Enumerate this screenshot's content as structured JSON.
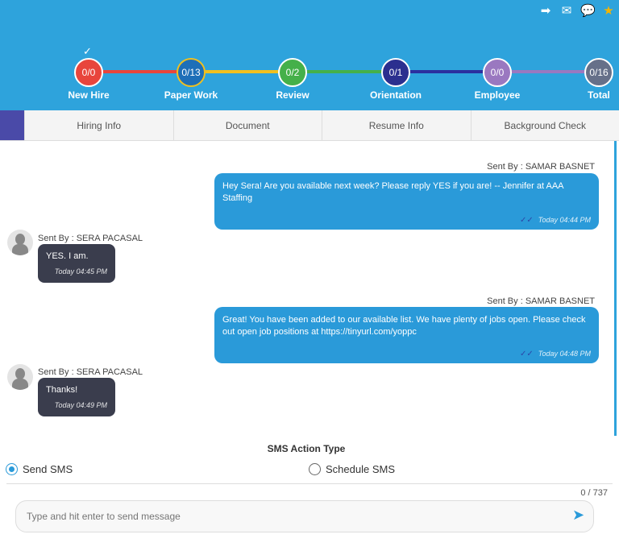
{
  "header": {
    "icons": [
      "arrow-right-icon",
      "mail-icon",
      "chat-icon",
      "star-icon"
    ],
    "steps": [
      {
        "label": "New Hire",
        "count": "0/0",
        "color": "#e8453c",
        "done": true
      },
      {
        "label": "Paper Work",
        "count": "0/13",
        "color": "#1e6fb8",
        "ring": "#f0c020"
      },
      {
        "label": "Review",
        "count": "0/2",
        "color": "#45b04a"
      },
      {
        "label": "Orientation",
        "count": "0/1",
        "color": "#2b2f8f"
      },
      {
        "label": "Employee",
        "count": "0/0",
        "color": "#9a78c0"
      },
      {
        "label": "Total",
        "count": "0/16",
        "color": "#667089"
      }
    ],
    "line_colors": [
      "#e8453c",
      "#f0c020",
      "#45b04a",
      "#2b2f9f",
      "#9a78c0"
    ]
  },
  "tabs": [
    "Hiring Info",
    "Document",
    "Resume Info",
    "Background Check"
  ],
  "messages": [
    {
      "sender": "Sent By : SAMAR BASNET",
      "text": "Hey Sera! Are you available next week? Please reply YES if you are! -- Jennifer at AAA Staffing",
      "time": "Today 04:44 PM",
      "outgoing": true
    },
    {
      "sender": "Sent By : SERA PACASAL",
      "text": "YES. I am.",
      "time": "Today 04:45 PM",
      "outgoing": false
    },
    {
      "sender": "Sent By : SAMAR BASNET",
      "text": "Great! You have been added to our available list. We have plenty of jobs open. Please check out open job positions at https://tinyurl.com/yoppc",
      "time": "Today 04:48 PM",
      "outgoing": true
    },
    {
      "sender": "Sent By : SERA PACASAL",
      "text": "Thanks!",
      "time": "Today 04:49 PM",
      "outgoing": false
    }
  ],
  "sms": {
    "title": "SMS Action Type",
    "options": [
      "Send SMS",
      "Schedule SMS"
    ],
    "selected": "Send SMS",
    "counter": "0 / 737",
    "placeholder": "Type and hit enter to send message"
  }
}
